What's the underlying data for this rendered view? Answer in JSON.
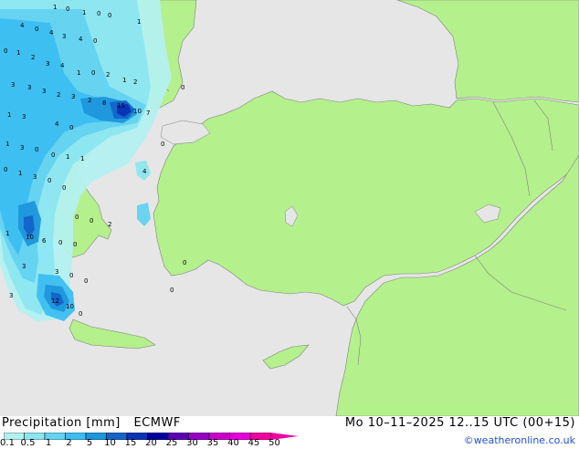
{
  "header": {
    "product": "Precipitation [mm]",
    "model": "ECMWF",
    "run_time": "Mo 10–11–2025 12..15 UTC (00+15)"
  },
  "credit": "©weatheronline.co.uk",
  "legend": {
    "labels": [
      "0.1",
      "0.5",
      "1",
      "2",
      "5",
      "10",
      "15",
      "20",
      "25",
      "30",
      "35",
      "40",
      "45",
      "50"
    ],
    "colors": [
      "#b4f0f0",
      "#8ce6f0",
      "#64d2f0",
      "#3cbef0",
      "#1e96dc",
      "#1464c8",
      "#0a32b4",
      "#0000a0",
      "#5a00b4",
      "#9600c8",
      "#c800c8",
      "#e600dc",
      "#f000a0"
    ]
  },
  "map": {
    "colors": {
      "sea": "#e6e6e6",
      "land": "#b4f08c",
      "border": "#808080"
    },
    "values": [
      {
        "v": "1"
      },
      {
        "v": "0"
      },
      {
        "v": "1"
      },
      {
        "v": "0"
      },
      {
        "v": "0"
      },
      {
        "v": "1"
      },
      {
        "v": "4"
      },
      {
        "v": "0"
      },
      {
        "v": "4"
      },
      {
        "v": "3"
      },
      {
        "v": "4"
      },
      {
        "v": "0"
      },
      {
        "v": "0"
      },
      {
        "v": "1"
      },
      {
        "v": "2"
      },
      {
        "v": "3"
      },
      {
        "v": "4"
      },
      {
        "v": "1"
      },
      {
        "v": "0"
      },
      {
        "v": "2"
      },
      {
        "v": "1"
      },
      {
        "v": "2"
      },
      {
        "v": "0"
      },
      {
        "v": "3"
      },
      {
        "v": "3"
      },
      {
        "v": "3"
      },
      {
        "v": "2"
      },
      {
        "v": "3"
      },
      {
        "v": "2"
      },
      {
        "v": "8"
      },
      {
        "v": "15"
      },
      {
        "v": "10"
      },
      {
        "v": "7"
      },
      {
        "v": "0"
      },
      {
        "v": "1"
      },
      {
        "v": "3"
      },
      {
        "v": "4"
      },
      {
        "v": "0"
      },
      {
        "v": "1"
      },
      {
        "v": "3"
      },
      {
        "v": "0"
      },
      {
        "v": "0"
      },
      {
        "v": "1"
      },
      {
        "v": "1"
      },
      {
        "v": "0"
      },
      {
        "v": "1"
      },
      {
        "v": "3"
      },
      {
        "v": "0"
      },
      {
        "v": "4"
      },
      {
        "v": "0"
      },
      {
        "v": "0"
      },
      {
        "v": "0"
      },
      {
        "v": "2"
      },
      {
        "v": "1"
      },
      {
        "v": "10"
      },
      {
        "v": "6"
      },
      {
        "v": "0"
      },
      {
        "v": "0"
      },
      {
        "v": "3"
      },
      {
        "v": "3"
      },
      {
        "v": "0"
      },
      {
        "v": "12"
      },
      {
        "v": "10"
      },
      {
        "v": "0"
      },
      {
        "v": "0"
      },
      {
        "v": "3"
      },
      {
        "v": "0"
      },
      {
        "v": "0"
      }
    ]
  }
}
